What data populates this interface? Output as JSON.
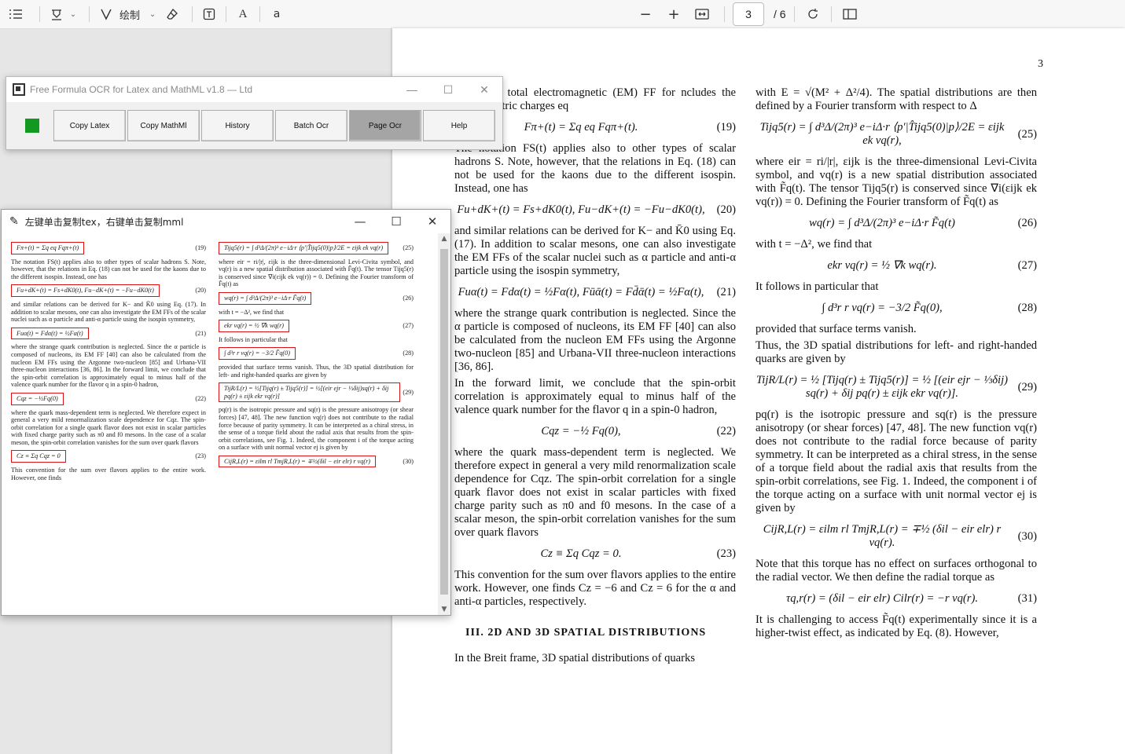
{
  "toolbar": {
    "draw_label": "绘制",
    "read_label": "A",
    "translate_label": "a",
    "current_page": "3",
    "total_pages": "/ 6"
  },
  "pdf": {
    "page_number": "3",
    "col_left": [
      {
        "type": "p",
        "text": "ₒ(t) is the total electromagnetic (EM) FF for ncludes the quark electric charges eq"
      },
      {
        "type": "eq",
        "f": "Fπ+(t) = Σq eq Fqπ+(t).",
        "n": "(19)"
      },
      {
        "type": "p",
        "text": "The notation FS(t) applies also to other types of scalar hadrons S. Note, however, that the relations in Eq. (18) can not be used for the kaons due to the different isospin. Instead, one has"
      },
      {
        "type": "eq",
        "f": "Fu+dK+(t) = Fs+dK0(t),    Fu−dK+(t) = −Fu−dK0(t),",
        "n": "(20)"
      },
      {
        "type": "p",
        "text": "and similar relations can be derived for K− and K̄0 using Eq. (17). In addition to scalar mesons, one can also investigate the EM FFs of the scalar nuclei such as α particle and anti-α particle using the isospin symmetry,"
      },
      {
        "type": "eq",
        "f": "Fuα(t) = Fdα(t) = ½Fα(t),   Fūᾱ(t) = Fd̄ᾱ(t) = ½Fα(t),",
        "n": "(21)"
      },
      {
        "type": "p",
        "text": "where the strange quark contribution is neglected. Since the α particle is composed of nucleons, its EM FF [40] can also be calculated from the nucleon EM FFs using the Argonne two-nucleon [85] and Urbana-VII three-nucleon interactions [36, 86]."
      },
      {
        "type": "p",
        "text": "In the forward limit, we conclude that the spin-orbit correlation is approximately equal to minus half of the valence quark number for the flavor q in a spin-0 hadron,"
      },
      {
        "type": "eq",
        "f": "Cqz = −½ Fq(0),",
        "n": "(22)"
      },
      {
        "type": "p",
        "text": "where the quark mass-dependent term is neglected. We therefore expect in general a very mild renormalization scale dependence for Cqz. The spin-orbit correlation for a single quark flavor does not exist in scalar particles with fixed charge parity such as π0 and f0 mesons. In the case of a scalar meson, the spin-orbit correlation vanishes for the sum over quark flavors"
      },
      {
        "type": "eq",
        "f": "Cz ≡ Σq Cqz = 0.",
        "n": "(23)"
      },
      {
        "type": "p",
        "text": "This convention for the sum over flavors applies to the entire work. However, one finds Cz = −6 and Cz = 6 for the α and anti-α particles, respectively."
      },
      {
        "type": "sec",
        "text": "III.   2D AND 3D SPATIAL DISTRIBUTIONS"
      },
      {
        "type": "p",
        "text": "In the Breit frame, 3D spatial distributions of quarks"
      }
    ],
    "col_right": [
      {
        "type": "p",
        "text": "with E = √(M² + Δ²/4). The spatial distributions are then defined by a Fourier transform with respect to Δ"
      },
      {
        "type": "eq",
        "f": "Tijq5(r) = ∫ d³Δ/(2π)³ e−iΔ·r ⟨p′|T̂ijq5(0)|p⟩/2E = εijk ek vq(r),",
        "n": "(25)"
      },
      {
        "type": "p",
        "text": "where eir = ri/|r|, εijk is the three-dimensional Levi-Civita symbol, and vq(r) is a new spatial distribution associated with F̃q(t). The tensor Tijq5(r) is conserved since ∇i(εijk ek vq(r)) = 0. Defining the Fourier transform of F̃q(t) as"
      },
      {
        "type": "eq",
        "f": "wq(r) = ∫ d³Δ/(2π)³ e−iΔ·r F̃q(t)",
        "n": "(26)"
      },
      {
        "type": "p",
        "text": "with t = −Δ², we find that"
      },
      {
        "type": "eq",
        "f": "ekr vq(r) = ½ ∇k wq(r).",
        "n": "(27)"
      },
      {
        "type": "p",
        "text": "It follows in particular that"
      },
      {
        "type": "eq",
        "f": "∫ d³r r vq(r) = −3/2 F̃q(0),",
        "n": "(28)"
      },
      {
        "type": "p",
        "text": "provided that surface terms vanish."
      },
      {
        "type": "p",
        "text": "Thus, the 3D spatial distributions for left- and right-handed quarks are given by"
      },
      {
        "type": "eq",
        "f": "TijR/L(r) = ½ [Tijq(r) ± Tijq5(r)] = ½ [(eir ejr − ⅓δij) sq(r) + δij pq(r) ± εijk ekr vq(r)].",
        "n": "(29)"
      },
      {
        "type": "p",
        "text": "pq(r) is the isotropic pressure and sq(r) is the pressure anisotropy (or shear forces) [47, 48]. The new function vq(r) does not contribute to the radial force because of parity symmetry. It can be interpreted as a chiral stress, in the sense of a torque field about the radial axis that results from the spin-orbit correlations, see Fig. 1. Indeed, the component i of the torque acting on a surface with unit normal vector ej is given by"
      },
      {
        "type": "eq",
        "f": "CijR,L(r) = εilm rl TmjR,L(r) = ∓½ (δil − eir elr) r vq(r).",
        "n": "(30)"
      },
      {
        "type": "p",
        "text": "Note that this torque has no effect on surfaces orthogonal to the radial vector. We then define the radial torque as"
      },
      {
        "type": "eq",
        "f": "τq,r(r) = (δil − eir elr) Cilr(r) = −r vq(r).",
        "n": "(31)"
      },
      {
        "type": "p",
        "text": "It is challenging to access F̃q(t) experimentally since it is a higher-twist effect, as indicated by Eq. (8). However,"
      }
    ]
  },
  "ocr_window": {
    "title": "Free Formula OCR for Latex and MathML v1.8 — Ltd",
    "buttons": [
      "Copy Latex",
      "Copy MathMl",
      "History",
      "Batch Ocr",
      "Page Ocr",
      "Help"
    ],
    "active_button": "Page Ocr",
    "status_color": "#119a1f"
  },
  "clip_window": {
    "title": "左键单击复制tex，右键单击复制mml",
    "mini_left": [
      {
        "type": "eq",
        "f": "Fπ+(t) = Σq eq Fqπ+(t)",
        "n": "(19)"
      },
      {
        "type": "p",
        "text": "The notation FS(t) applies also to other types of scalar hadrons S. Note, however, that the relations in Eq. (18) can not be used for the kaons due to the different isospin. Instead, one has"
      },
      {
        "type": "eq",
        "f": "Fu+dK+(t) = Fs+dK0(t),   Fu−dK+(t) = −Fu−dK0(t)",
        "n": "(20)"
      },
      {
        "type": "p",
        "text": "and similar relations can be derived for K− and K̄0 using Eq. (17). In addition to scalar mesons, one can also investigate the EM FFs of the scalar nuclei such as α particle and anti-α particle using the isospin symmetry,"
      },
      {
        "type": "eq",
        "f": "Fuα(t) = Fdα(t) = ½Fα(t)",
        "n": "(21)"
      },
      {
        "type": "p",
        "text": "where the strange quark contribution is neglected. Since the α particle is composed of nucleons, its EM FF [40] can also be calculated from the nucleon EM FFs using the Argonne two-nucleon [85] and Urbana-VII three-nucleon interactions [36, 86]. In the forward limit, we conclude that the spin-orbit correlation is approximately equal to minus half of the valence quark number for the flavor q in a spin-0 hadron,"
      },
      {
        "type": "eq",
        "f": "Cqz = −½Fq(0)",
        "n": "(22)"
      },
      {
        "type": "p",
        "text": "where the quark mass-dependent term is neglected. We therefore expect in general a very mild renormalization scale dependence for Cqz. The spin-orbit correlation for a single quark flavor does not exist in scalar particles with fixed charge parity such as π0 and f0 mesons. In the case of a scalar meson, the spin-orbit correlation vanishes for the sum over quark flavors"
      },
      {
        "type": "eq",
        "f": "Cz ≡ Σq Cqz = 0",
        "n": "(23)"
      },
      {
        "type": "p",
        "text": "This convention for the sum over flavors applies to the entire work. However, one finds"
      }
    ],
    "mini_right": [
      {
        "type": "eq",
        "f": "Tijq5(r) = ∫ d³Δ/(2π)³ e−iΔ·r ⟨p′|T̂ijq5(0)|p⟩/2E = εijk ek vq(r)",
        "n": "(25)"
      },
      {
        "type": "p",
        "text": "where eir = ri/|r|, εijk is the three-dimensional Levi-Civita symbol, and vq(r) is a new spatial distribution associated with F̃q(t). The tensor Tijq5(r) is conserved since ∇i(εijk ek vq(r)) = 0. Defining the Fourier transform of F̃q(t) as"
      },
      {
        "type": "eq",
        "f": "wq(r) = ∫ d³Δ/(2π)³ e−iΔ·r F̃q(t)",
        "n": "(26)"
      },
      {
        "type": "p",
        "text": "with t = −Δ², we find that"
      },
      {
        "type": "eq",
        "f": "ekr vq(r) = ½ ∇k wq(r)",
        "n": "(27)"
      },
      {
        "type": "p",
        "text": "It follows in particular that"
      },
      {
        "type": "eq",
        "f": "∫ d³r r vq(r) = −3/2 F̃q(0)",
        "n": "(28)"
      },
      {
        "type": "p",
        "text": "provided that surface terms vanish. Thus, the 3D spatial distribution for left- and right-handed quarks are given by"
      },
      {
        "type": "eq",
        "f": "TijR/L(r) = ½[Tijq(r) ± Tijq5(r)] = ½[(eir ejr − ⅓δij)sq(r) + δij pq(r) ± εijk ekr vq(r)]",
        "n": "(29)"
      },
      {
        "type": "p",
        "text": "pq(r) is the isotropic pressure and sq(r) is the pressure anisotropy (or shear forces) [47, 48]. The new function vq(r) does not contribute to the radial force because of parity symmetry. It can be interpreted as a chiral stress, in the sense of a torque field about the radial axis that results from the spin-orbit correlations, see Fig. 1. Indeed, the component i of the torque acting on a surface with unit normal vector ej is given by"
      },
      {
        "type": "eq",
        "f": "CijR,L(r) = εilm rl TmjR,L(r) = ∓½(δil − eir elr) r vq(r)",
        "n": "(30)"
      }
    ]
  }
}
